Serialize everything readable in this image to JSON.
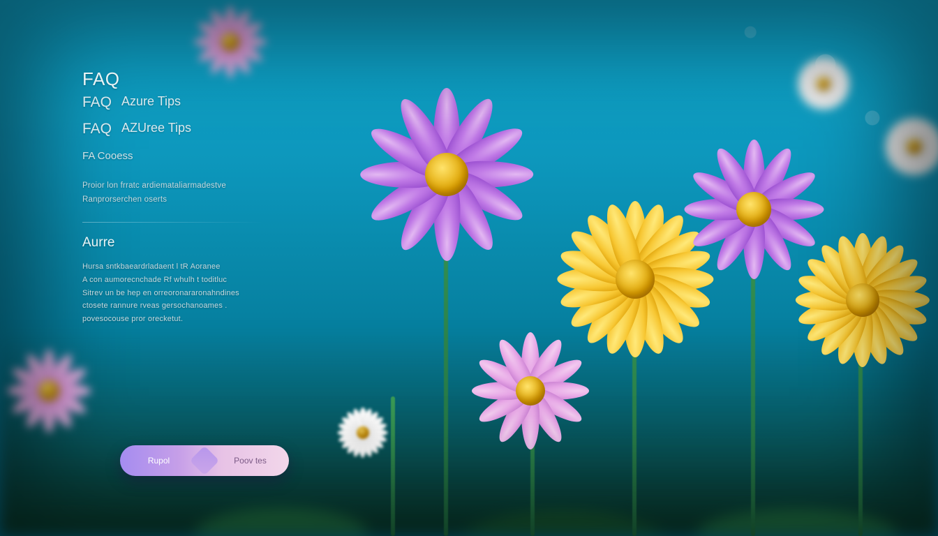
{
  "header": {
    "title_primary": "FAQ",
    "title_mid": "FAQ",
    "title_tail": "Azure Tips",
    "sub_primary": "FAQ",
    "sub_tail": "AZUree Tips",
    "tert": "FA Cooess"
  },
  "intro": {
    "line1": "Proior lon frratc ardiemataliarmadestve",
    "line2": "Ranprorserchen oserts"
  },
  "section": {
    "heading": "Aurre",
    "p1": "Hursa sntkbaeardrladaent l tR Aoranee",
    "p2": "A con aumorecnchade Rf whulh t toditluc",
    "p3": "Sitrev un be hep en orreoronararonahndines",
    "p4": "ctosete rannure rveas gersochanoames .",
    "p5": "povesocouse pror orecketut."
  },
  "pill": {
    "left": "Rupol",
    "right": "Poov tes"
  }
}
